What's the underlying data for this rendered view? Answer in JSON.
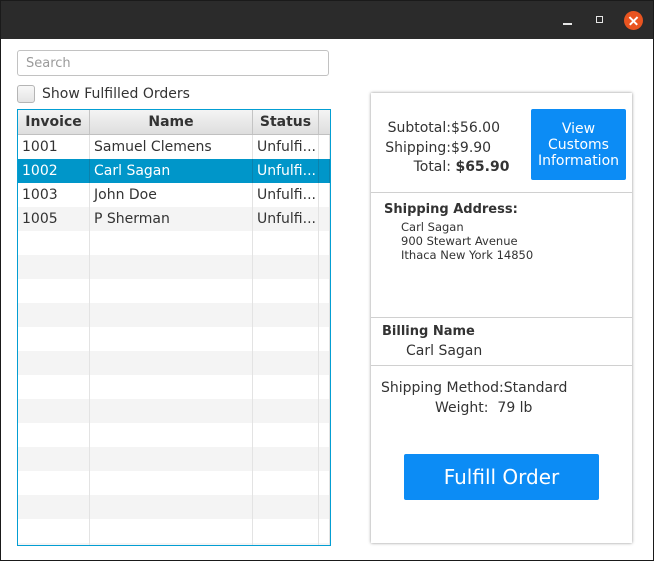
{
  "window": {
    "controls": {
      "minimize": "minimize-icon",
      "maximize": "maximize-icon",
      "close": "close-icon"
    },
    "close_color": "#e95420"
  },
  "search": {
    "placeholder": "Search",
    "value": ""
  },
  "filter": {
    "show_fulfilled_label": "Show Fulfilled Orders",
    "checked": false
  },
  "table": {
    "columns": [
      "Invoice",
      "Name",
      "Status"
    ],
    "rows": [
      {
        "invoice": "1001",
        "name": "Samuel Clemens",
        "status": "Unfulfi..."
      },
      {
        "invoice": "1002",
        "name": "Carl Sagan",
        "status": "Unfulfi...",
        "selected": true
      },
      {
        "invoice": "1003",
        "name": "John Doe",
        "status": "Unfulfi..."
      },
      {
        "invoice": "1005",
        "name": "P Sherman",
        "status": "Unfulfi..."
      }
    ],
    "selection_color": "#0096c9"
  },
  "totals": {
    "subtotal_label": "Subtotal:",
    "subtotal_value": "$56.00",
    "shipping_label": "Shipping:",
    "shipping_value": "$9.90",
    "total_label": "Total:",
    "total_value": "$65.90"
  },
  "customs_button": {
    "label": "View\nCustoms\nInformation"
  },
  "shipping_address": {
    "title": "Shipping Address:",
    "lines": [
      "Carl Sagan",
      "900 Stewart Avenue",
      "Ithaca New York 14850"
    ]
  },
  "billing": {
    "title": "Billing Name",
    "name": "Carl Sagan"
  },
  "shipping_method": {
    "method_label": "Shipping Method:",
    "method_value": "Standard",
    "weight_label": "Weight:",
    "weight_value": "79 lb"
  },
  "fulfill_button": {
    "label": "Fulfill Order"
  },
  "accent_color": "#0c8cf5"
}
